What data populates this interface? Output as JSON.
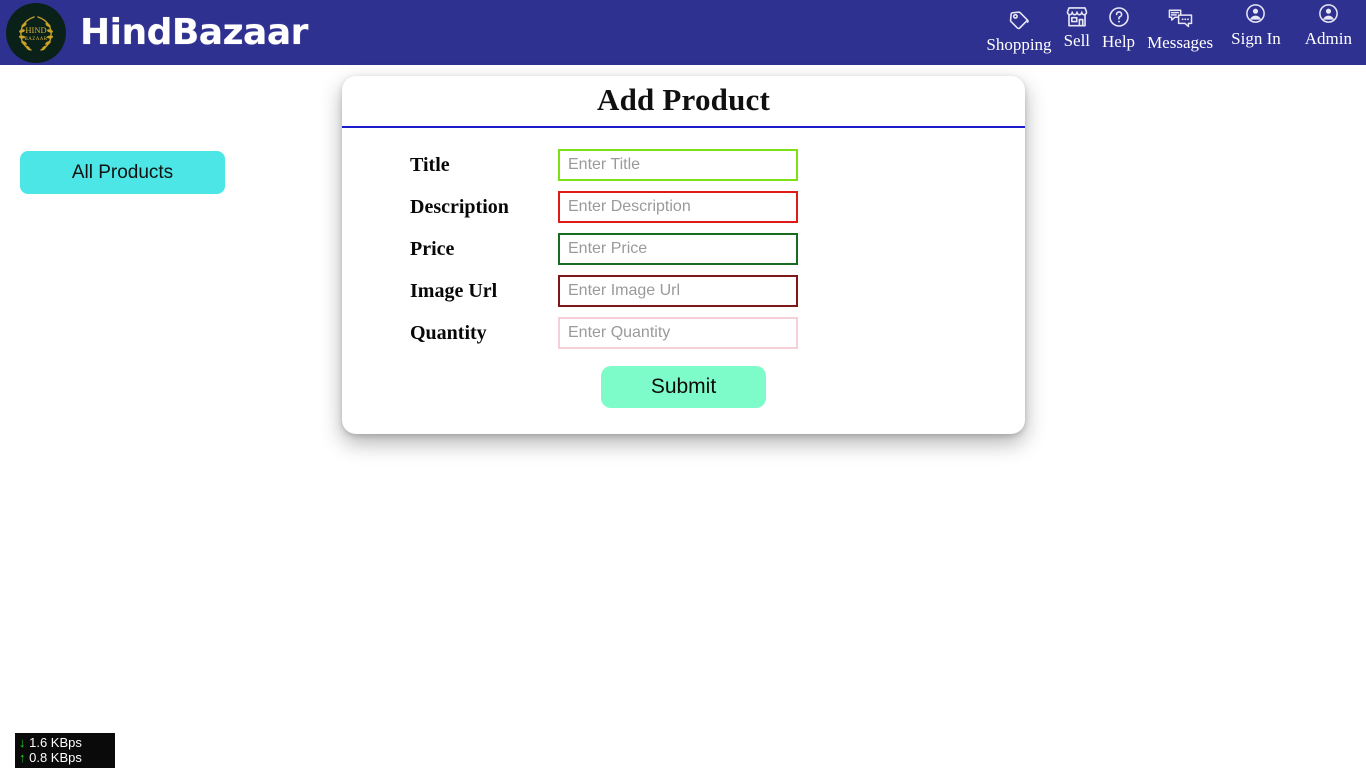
{
  "navbar": {
    "brand_name": "HindBazaar",
    "logo_text_top": "HIND",
    "logo_text_bottom": "BAZAAR",
    "background_color": "#2e3190",
    "items": [
      {
        "label": "Shopping",
        "icon": "tag-icon"
      },
      {
        "label": "Sell",
        "icon": "storefront-icon"
      },
      {
        "label": "Help",
        "icon": "help-circle-icon"
      },
      {
        "label": "Messages",
        "icon": "chat-bubbles-icon"
      },
      {
        "label": "Sign In",
        "icon": "account-circle-icon"
      },
      {
        "label": "Admin",
        "icon": "account-circle-icon"
      }
    ]
  },
  "sidebar": {
    "all_products_label": "All Products",
    "all_products_color": "#4ce6e6"
  },
  "card": {
    "title": "Add Product",
    "divider_color": "#1c1ccc",
    "fields": [
      {
        "label": "Title",
        "placeholder": "Enter Title",
        "value": "",
        "border_color": "#7ee017"
      },
      {
        "label": "Description",
        "placeholder": "Enter Description",
        "value": "",
        "border_color": "#e01b17"
      },
      {
        "label": "Price",
        "placeholder": "Enter Price",
        "value": "",
        "border_color": "#1a6b22"
      },
      {
        "label": "Image Url",
        "placeholder": "Enter Image Url",
        "value": "",
        "border_color": "#7e1818"
      },
      {
        "label": "Quantity",
        "placeholder": "Enter Quantity",
        "value": "",
        "border_color": "#f7cfd8"
      }
    ],
    "submit_label": "Submit",
    "submit_color": "#7dfbc8"
  },
  "netspeed": {
    "download": "1.6 KBps",
    "upload": "0.8 KBps",
    "down_arrow": "↓",
    "up_arrow": "↑",
    "arrow_color": "#25d425"
  }
}
